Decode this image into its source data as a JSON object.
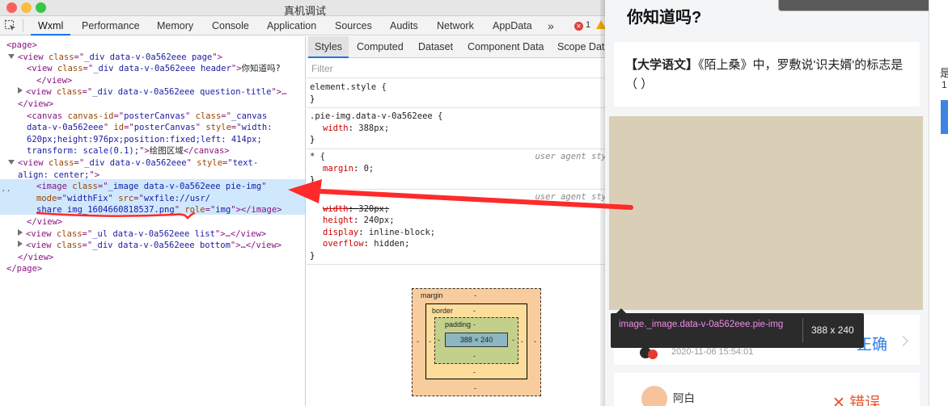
{
  "window": {
    "title": "真机调试"
  },
  "tabs": [
    {
      "label": "Wxml",
      "active": true
    },
    {
      "label": "Performance"
    },
    {
      "label": "Memory"
    },
    {
      "label": "Console"
    },
    {
      "label": "Application"
    },
    {
      "label": "Sources"
    },
    {
      "label": "Audits"
    },
    {
      "label": "Network"
    },
    {
      "label": "AppData"
    },
    {
      "label": "»"
    }
  ],
  "error_count": "1",
  "elements": {
    "lines": [
      {
        "indent": 8,
        "parts": [
          [
            "tag",
            "<page>"
          ]
        ]
      },
      {
        "indent": 10,
        "arrow": "down",
        "parts": [
          [
            "tag",
            "<view "
          ],
          [
            "attr",
            "class"
          ],
          [
            "tag",
            "=\""
          ],
          [
            "val",
            "_div data-v-0a562eee page"
          ],
          [
            "tag",
            "\">"
          ]
        ]
      },
      {
        "indent": 33,
        "parts": [
          [
            "tag",
            "<view "
          ],
          [
            "attr",
            "class"
          ],
          [
            "tag",
            "=\""
          ],
          [
            "val",
            "_div data-v-0a562eee header"
          ],
          [
            "tag",
            "\">"
          ],
          [
            "txt",
            "你知道吗?"
          ]
        ]
      },
      {
        "indent": 45,
        "parts": [
          [
            "tag",
            "</view>"
          ]
        ]
      },
      {
        "indent": 22,
        "arrow": "right",
        "parts": [
          [
            "tag",
            "<view "
          ],
          [
            "attr",
            "class"
          ],
          [
            "tag",
            "=\""
          ],
          [
            "val",
            "_div data-v-0a562eee question-title"
          ],
          [
            "tag",
            "\">…"
          ]
        ]
      },
      {
        "indent": 22,
        "parts": [
          [
            "tag",
            "</view>"
          ]
        ]
      },
      {
        "indent": 33,
        "parts": [
          [
            "tag",
            "<canvas "
          ],
          [
            "attr",
            "canvas-id"
          ],
          [
            "tag",
            "=\""
          ],
          [
            "val",
            "posterCanvas"
          ],
          [
            "tag",
            "\" "
          ],
          [
            "attr",
            "class"
          ],
          [
            "tag",
            "=\""
          ],
          [
            "val",
            "_canvas"
          ]
        ]
      },
      {
        "indent": 33,
        "parts": [
          [
            "val",
            "data-v-0a562eee"
          ],
          [
            "tag",
            "\" "
          ],
          [
            "attr",
            "id"
          ],
          [
            "tag",
            "=\""
          ],
          [
            "val",
            "posterCanvas"
          ],
          [
            "tag",
            "\" "
          ],
          [
            "attr",
            "style"
          ],
          [
            "tag",
            "=\""
          ],
          [
            "val",
            "width:"
          ]
        ]
      },
      {
        "indent": 33,
        "parts": [
          [
            "val",
            "620px;height:976px;position:fixed;left: 414px;"
          ]
        ]
      },
      {
        "indent": 33,
        "parts": [
          [
            "val",
            "transform: scale(0.1);"
          ],
          [
            "tag",
            "\">"
          ],
          [
            "txt",
            "绘图区域"
          ],
          [
            "tag",
            "</canvas>"
          ]
        ]
      },
      {
        "indent": 10,
        "arrow": "down",
        "parts": [
          [
            "tag",
            "<view "
          ],
          [
            "attr",
            "class"
          ],
          [
            "tag",
            "=\""
          ],
          [
            "val",
            "_div data-v-0a562eee"
          ],
          [
            "tag",
            "\" "
          ],
          [
            "attr",
            "style"
          ],
          [
            "tag",
            "=\""
          ],
          [
            "val",
            "text-"
          ]
        ]
      },
      {
        "indent": 22,
        "parts": [
          [
            "val",
            "align: center;"
          ],
          [
            "tag",
            "\">"
          ]
        ]
      },
      {
        "indent": 45,
        "parts": [
          [
            "tag",
            "<image "
          ],
          [
            "attr",
            "class"
          ],
          [
            "tag",
            "=\""
          ],
          [
            "val",
            "_image data-v-0a562eee pie-img"
          ],
          [
            "tag",
            "\""
          ]
        ]
      },
      {
        "indent": 45,
        "parts": [
          [
            "attr",
            "mode"
          ],
          [
            "tag",
            "=\""
          ],
          [
            "val",
            "widthFix"
          ],
          [
            "tag",
            "\" "
          ],
          [
            "attr",
            "src"
          ],
          [
            "tag",
            "=\""
          ],
          [
            "val",
            "wxfile://usr/"
          ]
        ]
      },
      {
        "indent": 45,
        "parts": [
          [
            "val",
            "share_img_1604660818537.png"
          ],
          [
            "tag",
            "\" "
          ],
          [
            "attr",
            "role"
          ],
          [
            "tag",
            "=\""
          ],
          [
            "val",
            "img"
          ],
          [
            "tag",
            "\"></image>"
          ]
        ]
      },
      {
        "indent": 33,
        "parts": [
          [
            "tag",
            "</view>"
          ]
        ]
      },
      {
        "indent": 22,
        "arrow": "right",
        "parts": [
          [
            "tag",
            "<view "
          ],
          [
            "attr",
            "class"
          ],
          [
            "tag",
            "=\""
          ],
          [
            "val",
            "_ul data-v-0a562eee list"
          ],
          [
            "tag",
            "\">…</view>"
          ]
        ]
      },
      {
        "indent": 22,
        "arrow": "right",
        "parts": [
          [
            "tag",
            "<view "
          ],
          [
            "attr",
            "class"
          ],
          [
            "tag",
            "=\""
          ],
          [
            "val",
            "_div data-v-0a562eee bottom"
          ],
          [
            "tag",
            "\">…</view>"
          ]
        ]
      },
      {
        "indent": 22,
        "parts": [
          [
            "tag",
            "</view>"
          ]
        ]
      },
      {
        "indent": 8,
        "parts": [
          [
            "tag",
            "</page>"
          ]
        ]
      }
    ],
    "dots": ".."
  },
  "styles": {
    "subtabs": [
      "Styles",
      "Computed",
      "Dataset",
      "Component Data",
      "Scope Data"
    ],
    "filter_placeholder": "Filter",
    "rules": [
      {
        "selector": "element.style {",
        "props": [],
        "close": "}"
      },
      {
        "selector": ".pie-img.data-v-0a562eee {",
        "props": [
          {
            "name": "width",
            "value": "388px;",
            "strike": false
          }
        ],
        "close": "}"
      },
      {
        "selector": "* {",
        "source": "user agent sty",
        "props": [
          {
            "name": "margin",
            "value": "0;",
            "strike": false
          }
        ],
        "close": "}"
      },
      {
        "selector": "",
        "source": "user agent sty",
        "props": [
          {
            "name": "width",
            "value": "320px;",
            "strike": true
          },
          {
            "name": "height",
            "value": "240px;",
            "strike": false
          },
          {
            "name": "display",
            "value": "inline-block;",
            "strike": false
          },
          {
            "name": "overflow",
            "value": "hidden;",
            "strike": false
          }
        ],
        "close": "}"
      }
    ],
    "box_model": {
      "margin_label": "margin",
      "border_label": "border",
      "padding_label": "padding",
      "content": "388 × 240",
      "dash": "-"
    }
  },
  "simulator": {
    "title": "你知道吗?",
    "question_bracket": "【大学语文】",
    "question_text": "《陌上桑》中，罗敷说'识夫婿'的标志是（ ）",
    "tooltip_name_prefix": "image.",
    "tooltip_name": "_image.data-v-0a562eee.pie-img",
    "tooltip_size": "388 x 240",
    "answer1": {
      "date": "2020-11-06 15:54:01",
      "result": "正确"
    },
    "answer2": {
      "name": "阿白",
      "result": "✕ 错误"
    },
    "right_strip_chars": [
      "是",
      "1"
    ]
  },
  "colors": {
    "arrow": "#ff2a2a",
    "accent_blue": "#2f7de1",
    "error_red": "#e8522c",
    "image_fill": "#d9cfb6"
  }
}
